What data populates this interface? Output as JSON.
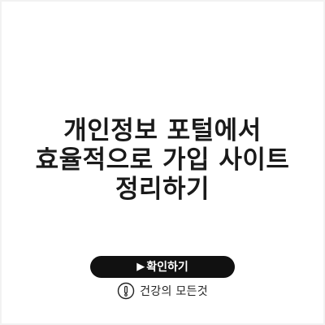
{
  "headline": {
    "lines": [
      "개인정보 포털에서",
      "효율적으로 가입 사이트",
      "정리하기"
    ]
  },
  "cta": {
    "arrow": "▶",
    "label": "확인하기"
  },
  "brand": {
    "icon": "exclamation-circle-icon",
    "name": "건강의 모든것"
  },
  "colors": {
    "background": "#ffffff",
    "text": "#1a1a1a",
    "button": "#111111",
    "button_text": "#ffffff"
  }
}
